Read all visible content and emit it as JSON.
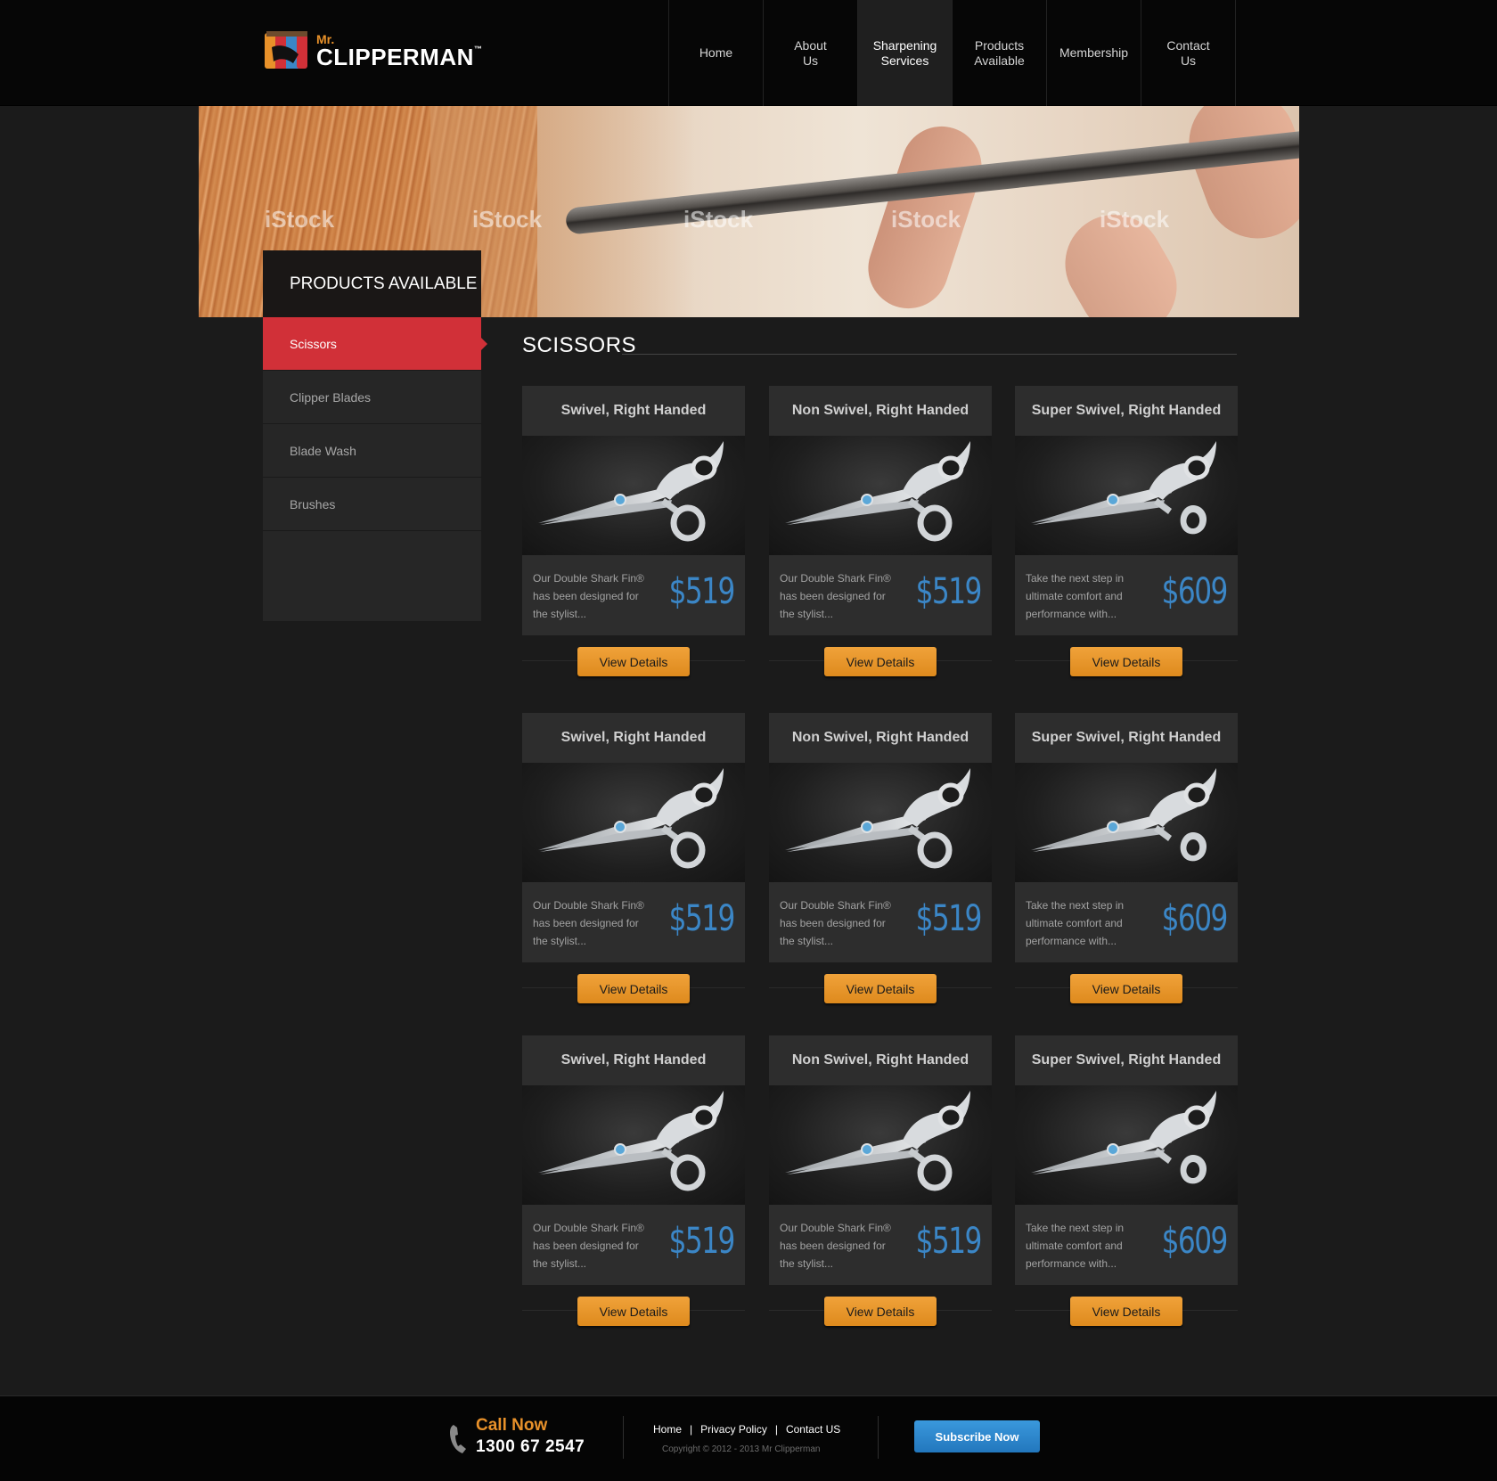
{
  "brand": {
    "prefix": "Mr.",
    "name": "CLIPPERMAN",
    "tm": "™"
  },
  "nav": [
    {
      "label": "Home"
    },
    {
      "label": "About\nUs"
    },
    {
      "label": "Sharpening\nServices"
    },
    {
      "label": "Products\nAvailable"
    },
    {
      "label": "Membership"
    },
    {
      "label": "Contact\nUs"
    }
  ],
  "nav_active": "Sharpening Services",
  "banner": {
    "watermark": "iStock"
  },
  "sidebar": {
    "title": "PRODUCTS AVAILABLE",
    "items": [
      {
        "label": "Scissors"
      },
      {
        "label": "Clipper Blades"
      },
      {
        "label": "Blade Wash"
      },
      {
        "label": "Brushes"
      }
    ],
    "active": "Scissors"
  },
  "section": {
    "title": "SCISSORS"
  },
  "products": [
    {
      "name": "Swivel, Right Handed",
      "desc": "Our Double Shark Fin® has been designed for the stylist...",
      "price": "$519",
      "button": "View Details"
    },
    {
      "name": "Non Swivel, Right Handed",
      "desc": "Our Double Shark Fin® has been designed for the stylist...",
      "price": "$519",
      "button": "View Details"
    },
    {
      "name": "Super Swivel, Right Handed",
      "desc": "Take the next step in ultimate comfort and performance with...",
      "price": "$609",
      "button": "View Details"
    },
    {
      "name": "Swivel, Right Handed",
      "desc": "Our Double Shark Fin® has been designed for the stylist...",
      "price": "$519",
      "button": "View Details"
    },
    {
      "name": "Non Swivel, Right Handed",
      "desc": "Our Double Shark Fin® has been designed for the stylist...",
      "price": "$519",
      "button": "View Details"
    },
    {
      "name": "Super Swivel, Right Handed",
      "desc": "Take the next step in ultimate comfort and performance with...",
      "price": "$609",
      "button": "View Details"
    },
    {
      "name": "Swivel, Right Handed",
      "desc": "Our Double Shark Fin® has been designed for the stylist...",
      "price": "$519",
      "button": "View Details"
    },
    {
      "name": "Non Swivel, Right Handed",
      "desc": "Our Double Shark Fin® has been designed for the stylist...",
      "price": "$519",
      "button": "View Details"
    },
    {
      "name": "Super Swivel, Right Handed",
      "desc": "Take the next step in ultimate comfort and performance with...",
      "price": "$609",
      "button": "View Details"
    }
  ],
  "footer": {
    "call_label": "Call Now",
    "call_number": "1300 67 2547",
    "links": [
      {
        "label": "Home"
      },
      {
        "label": "Privacy Policy"
      },
      {
        "label": "Contact US"
      }
    ],
    "separator": "|",
    "copyright": "Copyright © 2012 - 2013 Mr Clipperman",
    "subscribe": "Subscribe Now"
  },
  "colors": {
    "accent_red": "#d13038",
    "accent_orange": "#e8912a",
    "price_blue": "#3b86c6",
    "subscribe_blue": "#2a85cc"
  },
  "icons": [
    "logo-icon",
    "phone-icon",
    "scissors-icon"
  ]
}
